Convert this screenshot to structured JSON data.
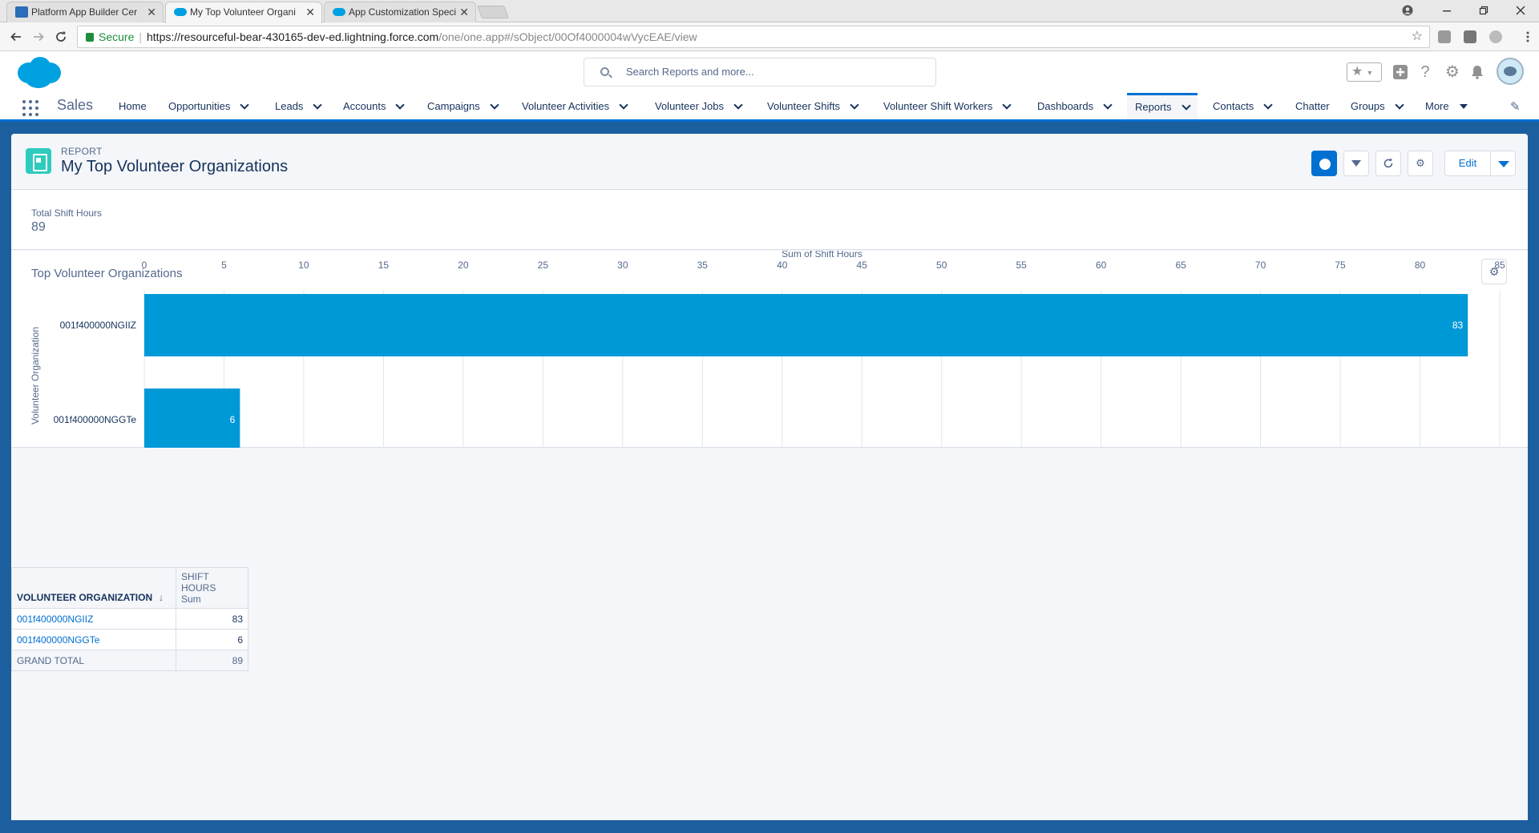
{
  "browser": {
    "tabs": [
      {
        "title": "Platform App Builder Cer",
        "active": false,
        "icon": "document-icon"
      },
      {
        "title": "My Top Volunteer Organi",
        "active": true,
        "icon": "salesforce-cloud-icon"
      },
      {
        "title": "App Customization Speci",
        "active": false,
        "icon": "salesforce-cloud-icon"
      }
    ],
    "close_glyph": "✕",
    "secure_label": "Secure",
    "url_host": "https://resourceful-bear-430165-dev-ed.lightning.force.com",
    "url_path": "/one/one.app#/sObject/00Of4000004wVycEAE/view"
  },
  "header": {
    "search_placeholder": "Search Reports and more..."
  },
  "appnav": {
    "app_name": "Sales",
    "items": [
      {
        "label": "Home",
        "has_menu": false
      },
      {
        "label": "Opportunities",
        "has_menu": true
      },
      {
        "label": "Leads",
        "has_menu": true
      },
      {
        "label": "Accounts",
        "has_menu": true
      },
      {
        "label": "Campaigns",
        "has_menu": true
      },
      {
        "label": "Volunteer Activities",
        "has_menu": true
      },
      {
        "label": "Volunteer Jobs",
        "has_menu": true
      },
      {
        "label": "Volunteer Shifts",
        "has_menu": true
      },
      {
        "label": "Volunteer Shift Workers",
        "has_menu": true
      },
      {
        "label": "Dashboards",
        "has_menu": true
      },
      {
        "label": "Reports",
        "has_menu": true,
        "active": true
      },
      {
        "label": "Contacts",
        "has_menu": true
      },
      {
        "label": "Chatter",
        "has_menu": false
      },
      {
        "label": "Groups",
        "has_menu": true
      },
      {
        "label": "More",
        "has_menu": true
      }
    ]
  },
  "report": {
    "kicker": "REPORT",
    "title": "My Top Volunteer Organizations",
    "edit_label": "Edit",
    "summary_label": "Total Shift Hours",
    "summary_value": "89"
  },
  "chart_data": {
    "type": "bar",
    "orientation": "horizontal",
    "title": "Top Volunteer Organizations",
    "xlabel": "Sum of Shift Hours",
    "ylabel": "Volunteer Organization",
    "categories": [
      "001f400000NGIIZ",
      "001f400000NGGTe"
    ],
    "values": [
      83,
      6
    ],
    "xlim": [
      0,
      85
    ],
    "xticks": [
      0,
      5,
      10,
      15,
      20,
      25,
      30,
      35,
      40,
      45,
      50,
      55,
      60,
      65,
      70,
      75,
      80,
      85
    ],
    "bar_color": "#0099d8",
    "grid": true
  },
  "table": {
    "group_header": "VOLUNTEER ORGANIZATION",
    "sort_glyph": "↓",
    "value_header": "SHIFT HOURS",
    "value_subheader": "Sum",
    "rows": [
      {
        "name": "001f400000NGIIZ",
        "value": "83"
      },
      {
        "name": "001f400000NGGTe",
        "value": "6"
      }
    ],
    "total_label": "GRAND TOTAL",
    "total_value": "89"
  },
  "colors": {
    "brand": "#0070d2",
    "bar": "#0099d8",
    "page_band": "#1b5f9e"
  }
}
